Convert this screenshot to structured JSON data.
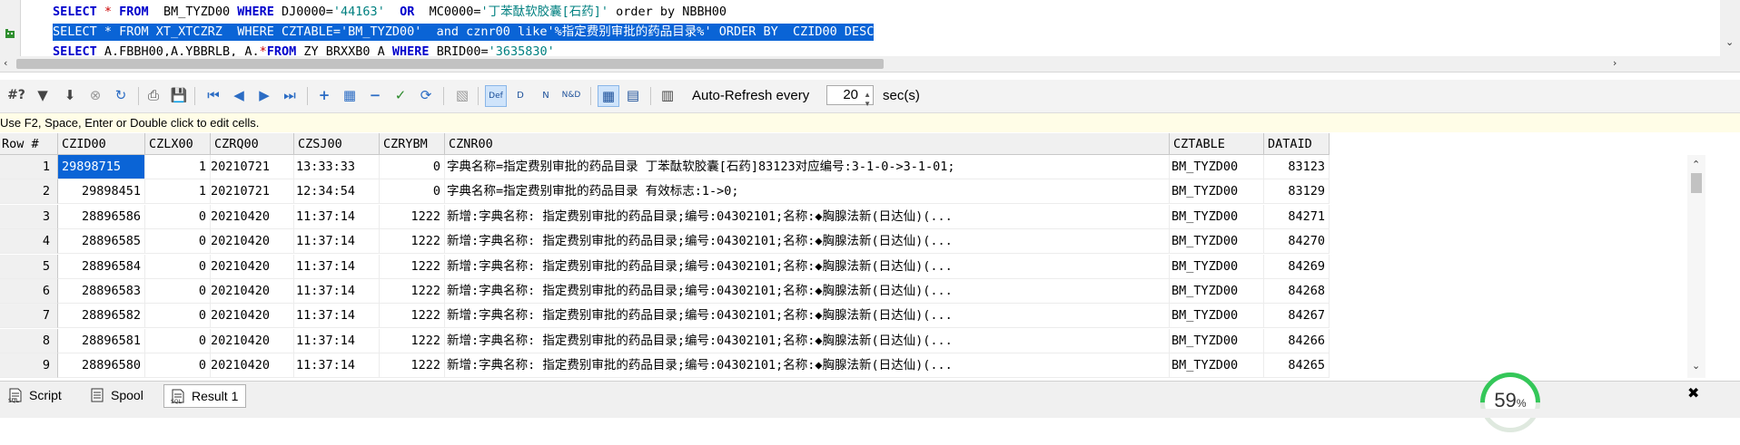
{
  "editor": {
    "lines": [
      {
        "parts": [
          [
            "kw",
            "SELECT "
          ],
          [
            "op",
            "* "
          ],
          [
            "kw",
            "FROM  "
          ],
          [
            "",
            "BM_TYZD00 "
          ],
          [
            "kw",
            "WHERE "
          ],
          [
            "",
            "DJ0000="
          ],
          [
            "str",
            "'44163'  "
          ],
          [
            "kw",
            "OR  "
          ],
          [
            "",
            "MC0000="
          ],
          [
            "str",
            "'丁苯酞软胶囊[石药]' "
          ],
          [
            "",
            "order by NBBH00"
          ]
        ]
      },
      {
        "parts": [
          [
            "",
            "SELECT * FROM XT_XTCZRZ  WHERE CZTABLE='BM_TYZD00'  and cznr00 like'%指定费别审批的药品目录%' ORDER BY  CZID00 DESC"
          ]
        ],
        "selected": true
      },
      {
        "parts": [
          [
            "kw",
            "SELECT "
          ],
          [
            "",
            "A.FBBH00,A.YBBRLB, A."
          ],
          [
            "op",
            "*"
          ],
          [
            "kw",
            "FROM "
          ],
          [
            "",
            "ZY_BRXXB0 A "
          ],
          [
            "kw",
            "WHERE "
          ],
          [
            "",
            "BRID00="
          ],
          [
            "str",
            "'3635830'"
          ]
        ]
      }
    ]
  },
  "toolbar": {
    "auto_refresh_label": "Auto-Refresh every",
    "auto_refresh_value": "20",
    "auto_refresh_unit": "sec(s)"
  },
  "hint": "Use F2, Space, Enter or Double click to edit cells.",
  "grid": {
    "columns": [
      "Row #",
      "CZID00",
      "CZLX00",
      "CZRQ00",
      "CZSJ00",
      "CZRYBM",
      "CZNR00",
      "CZTABLE",
      "DATAID"
    ],
    "rows": [
      [
        "1",
        "29898715",
        "1",
        "20210721",
        "13:33:33",
        "0",
        "字典名称=指定费别审批的药品目录 丁苯酞软胶囊[石药]83123对应编号:3-1-0->3-1-01;",
        "BM_TYZD00",
        "83123"
      ],
      [
        "2",
        "29898451",
        "1",
        "20210721",
        "12:34:54",
        "0",
        "字典名称=指定费别审批的药品目录 有效标志:1->0;",
        "BM_TYZD00",
        "83129"
      ],
      [
        "3",
        "28896586",
        "0",
        "20210420",
        "11:37:14",
        "1222",
        "新增:字典名称: 指定费别审批的药品目录;编号:04302101;名称:◆胸腺法新(日达仙)(...",
        "BM_TYZD00",
        "84271"
      ],
      [
        "4",
        "28896585",
        "0",
        "20210420",
        "11:37:14",
        "1222",
        "新增:字典名称: 指定费别审批的药品目录;编号:04302101;名称:◆胸腺法新(日达仙)(...",
        "BM_TYZD00",
        "84270"
      ],
      [
        "5",
        "28896584",
        "0",
        "20210420",
        "11:37:14",
        "1222",
        "新增:字典名称: 指定费别审批的药品目录;编号:04302101;名称:◆胸腺法新(日达仙)(...",
        "BM_TYZD00",
        "84269"
      ],
      [
        "6",
        "28896583",
        "0",
        "20210420",
        "11:37:14",
        "1222",
        "新增:字典名称: 指定费别审批的药品目录;编号:04302101;名称:◆胸腺法新(日达仙)(...",
        "BM_TYZD00",
        "84268"
      ],
      [
        "7",
        "28896582",
        "0",
        "20210420",
        "11:37:14",
        "1222",
        "新增:字典名称: 指定费别审批的药品目录;编号:04302101;名称:◆胸腺法新(日达仙)(...",
        "BM_TYZD00",
        "84267"
      ],
      [
        "8",
        "28896581",
        "0",
        "20210420",
        "11:37:14",
        "1222",
        "新增:字典名称: 指定费别审批的药品目录;编号:04302101;名称:◆胸腺法新(日达仙)(...",
        "BM_TYZD00",
        "84266"
      ],
      [
        "9",
        "28896580",
        "0",
        "20210420",
        "11:37:14",
        "1222",
        "新增:字典名称: 指定费别审批的药品目录;编号:04302101;名称:◆胸腺法新(日达仙)(...",
        "BM_TYZD00",
        "84265"
      ]
    ]
  },
  "tabs": [
    {
      "label": "Script",
      "icon": "sql-script-icon",
      "active": false
    },
    {
      "label": "Spool",
      "icon": "spool-icon",
      "active": false
    },
    {
      "label": "Result 1",
      "icon": "sql-result-icon",
      "active": true
    }
  ],
  "gauge": {
    "value": "59",
    "unit": "%"
  },
  "colors": {
    "selection": "#0a64d6",
    "keyword": "#0000cc",
    "string": "#008080",
    "hint_bg": "#fffde7",
    "gauge": "#34c759"
  }
}
